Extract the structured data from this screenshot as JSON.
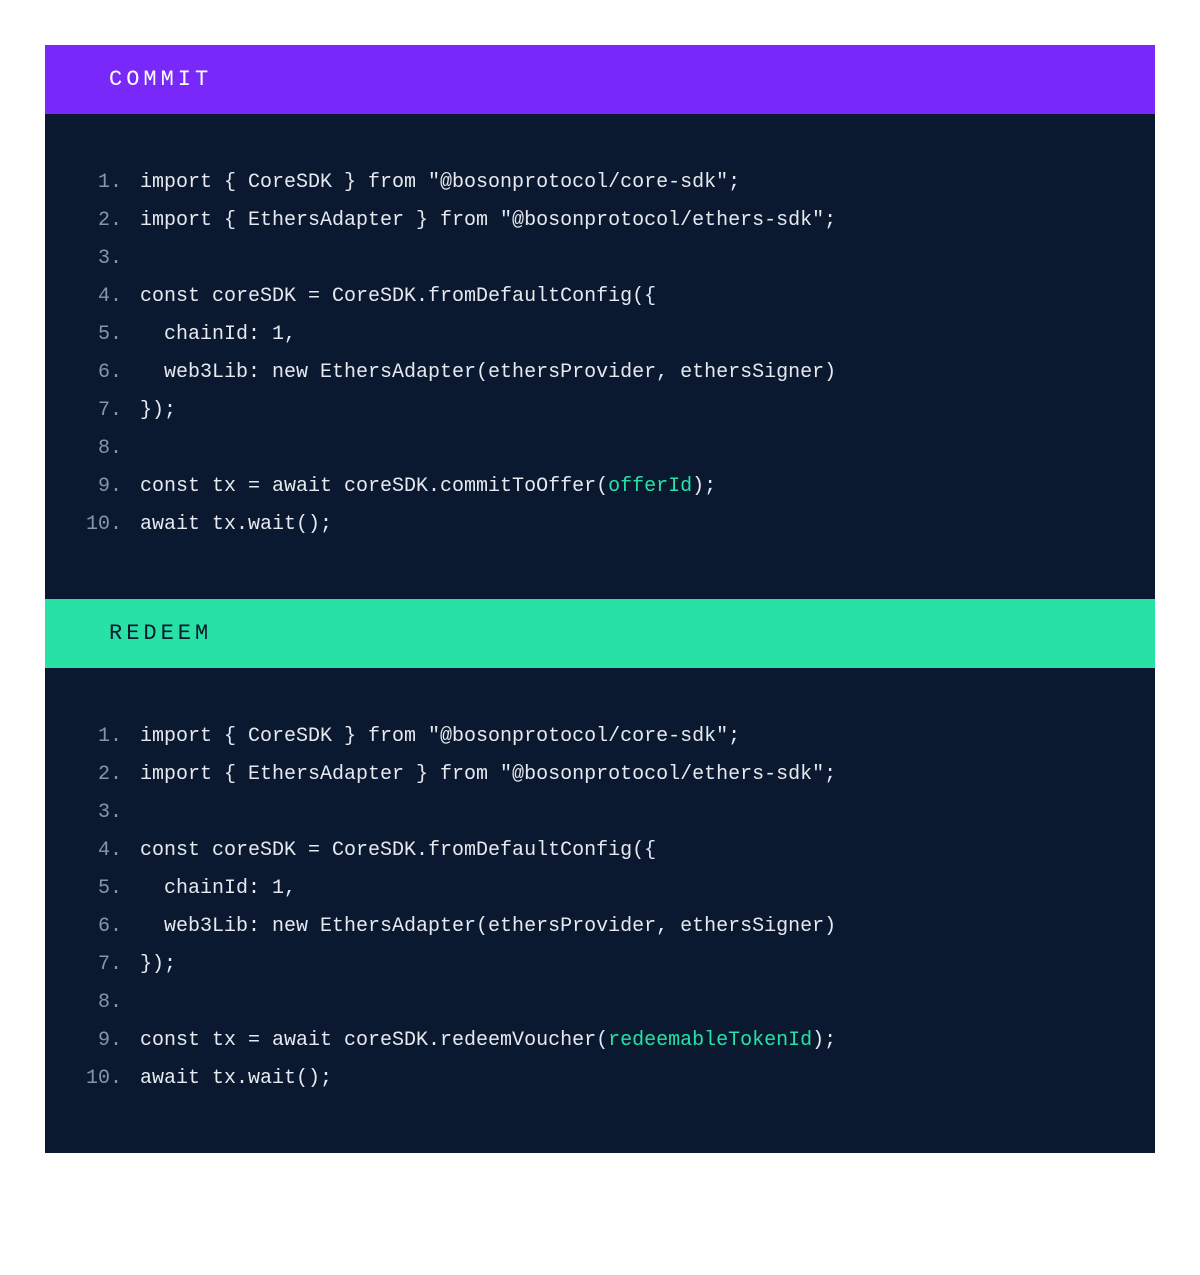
{
  "blocks": [
    {
      "id": "commit",
      "title": "COMMIT",
      "headerClass": "header-commit",
      "lines": [
        {
          "n": "1.",
          "segs": [
            {
              "t": "import { CoreSDK } from \"@bosonprotocol/core-sdk\";"
            }
          ]
        },
        {
          "n": "2.",
          "segs": [
            {
              "t": "import { EthersAdapter } from \"@bosonprotocol/ethers-sdk\";"
            }
          ]
        },
        {
          "n": "3.",
          "segs": [
            {
              "t": ""
            }
          ]
        },
        {
          "n": "4.",
          "segs": [
            {
              "t": "const coreSDK = CoreSDK.fromDefaultConfig({"
            }
          ]
        },
        {
          "n": "5.",
          "segs": [
            {
              "t": "  chainId: 1,"
            }
          ]
        },
        {
          "n": "6.",
          "segs": [
            {
              "t": "  web3Lib: new EthersAdapter(ethersProvider, ethersSigner)"
            }
          ]
        },
        {
          "n": "7.",
          "segs": [
            {
              "t": "});"
            }
          ]
        },
        {
          "n": "8.",
          "segs": [
            {
              "t": ""
            }
          ]
        },
        {
          "n": "9.",
          "segs": [
            {
              "t": "const tx = await coreSDK.commitToOffer("
            },
            {
              "t": "offerId",
              "hl": true
            },
            {
              "t": ");"
            }
          ]
        },
        {
          "n": "10.",
          "segs": [
            {
              "t": "await tx.wait();"
            }
          ]
        }
      ]
    },
    {
      "id": "redeem",
      "title": "REDEEM",
      "headerClass": "header-redeem",
      "lines": [
        {
          "n": "1.",
          "segs": [
            {
              "t": "import { CoreSDK } from \"@bosonprotocol/core-sdk\";"
            }
          ]
        },
        {
          "n": "2.",
          "segs": [
            {
              "t": "import { EthersAdapter } from \"@bosonprotocol/ethers-sdk\";"
            }
          ]
        },
        {
          "n": "3.",
          "segs": [
            {
              "t": ""
            }
          ]
        },
        {
          "n": "4.",
          "segs": [
            {
              "t": "const coreSDK = CoreSDK.fromDefaultConfig({"
            }
          ]
        },
        {
          "n": "5.",
          "segs": [
            {
              "t": "  chainId: 1,"
            }
          ]
        },
        {
          "n": "6.",
          "segs": [
            {
              "t": "  web3Lib: new EthersAdapter(ethersProvider, ethersSigner)"
            }
          ]
        },
        {
          "n": "7.",
          "segs": [
            {
              "t": "});"
            }
          ]
        },
        {
          "n": "8.",
          "segs": [
            {
              "t": ""
            }
          ]
        },
        {
          "n": "9.",
          "segs": [
            {
              "t": "const tx = await coreSDK.redeemVoucher("
            },
            {
              "t": "redeemableTokenId",
              "hl": true
            },
            {
              "t": ");"
            }
          ]
        },
        {
          "n": "10.",
          "segs": [
            {
              "t": "await tx.wait();"
            }
          ]
        }
      ]
    }
  ]
}
